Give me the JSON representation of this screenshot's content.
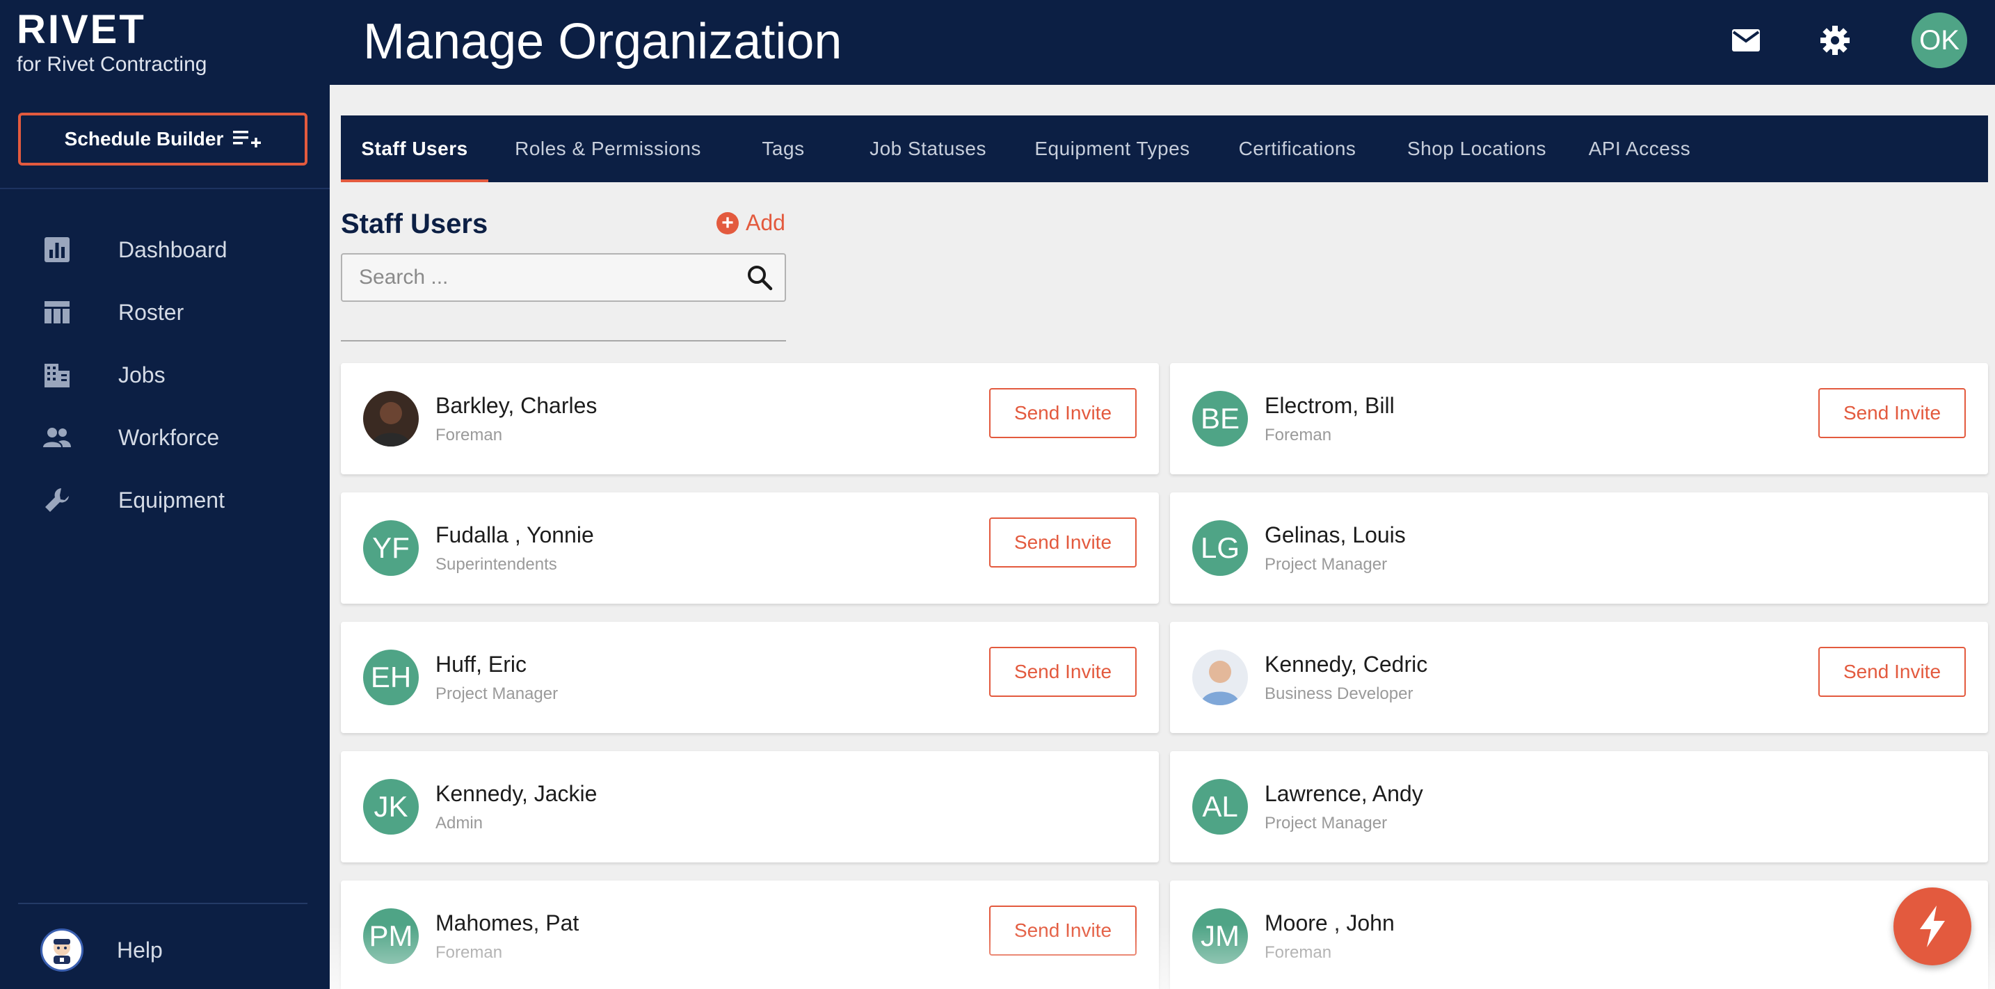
{
  "brand": {
    "name": "RIVET",
    "subtitle": "for Rivet Contracting"
  },
  "sidebar": {
    "schedule_button": "Schedule Builder",
    "items": [
      {
        "label": "Dashboard",
        "icon": "dashboard-icon"
      },
      {
        "label": "Roster",
        "icon": "roster-icon"
      },
      {
        "label": "Jobs",
        "icon": "jobs-icon"
      },
      {
        "label": "Workforce",
        "icon": "workforce-icon"
      },
      {
        "label": "Equipment",
        "icon": "wrench-icon"
      }
    ],
    "help_label": "Help"
  },
  "header": {
    "title": "Manage Organization",
    "user_initials": "OK"
  },
  "tabs": [
    {
      "label": "Staff Users",
      "active": true
    },
    {
      "label": "Roles & Permissions"
    },
    {
      "label": "Tags"
    },
    {
      "label": "Job Statuses"
    },
    {
      "label": "Equipment Types"
    },
    {
      "label": "Certifications"
    },
    {
      "label": "Shop Locations"
    },
    {
      "label": "API Access"
    }
  ],
  "section": {
    "title": "Staff Users",
    "add_label": "Add"
  },
  "search": {
    "placeholder": "Search ..."
  },
  "invite_label": "Send Invite",
  "users": [
    {
      "name": "Barkley, Charles",
      "role": "Foreman",
      "initials": "",
      "photo": "dark",
      "invite": true
    },
    {
      "name": "Electrom, Bill",
      "role": "Foreman",
      "initials": "BE",
      "invite": true
    },
    {
      "name": "Fudalla , Yonnie",
      "role": "Superintendents",
      "initials": "YF",
      "invite": true
    },
    {
      "name": "Gelinas, Louis",
      "role": "Project Manager",
      "initials": "LG",
      "invite": false
    },
    {
      "name": "Huff, Eric",
      "role": "Project Manager",
      "initials": "EH",
      "invite": true
    },
    {
      "name": "Kennedy, Cedric",
      "role": "Business Developer",
      "initials": "",
      "photo": "light",
      "invite": true
    },
    {
      "name": "Kennedy, Jackie",
      "role": "Admin",
      "initials": "JK",
      "invite": false
    },
    {
      "name": "Lawrence, Andy",
      "role": "Project Manager",
      "initials": "AL",
      "invite": false
    },
    {
      "name": "Mahomes, Pat",
      "role": "Foreman",
      "initials": "PM",
      "invite": true
    },
    {
      "name": "Moore , John",
      "role": "Foreman",
      "initials": "JM",
      "invite": false
    }
  ],
  "colors": {
    "navy": "#0c1f44",
    "accent": "#e35a3e",
    "avatar": "#4fa486"
  }
}
